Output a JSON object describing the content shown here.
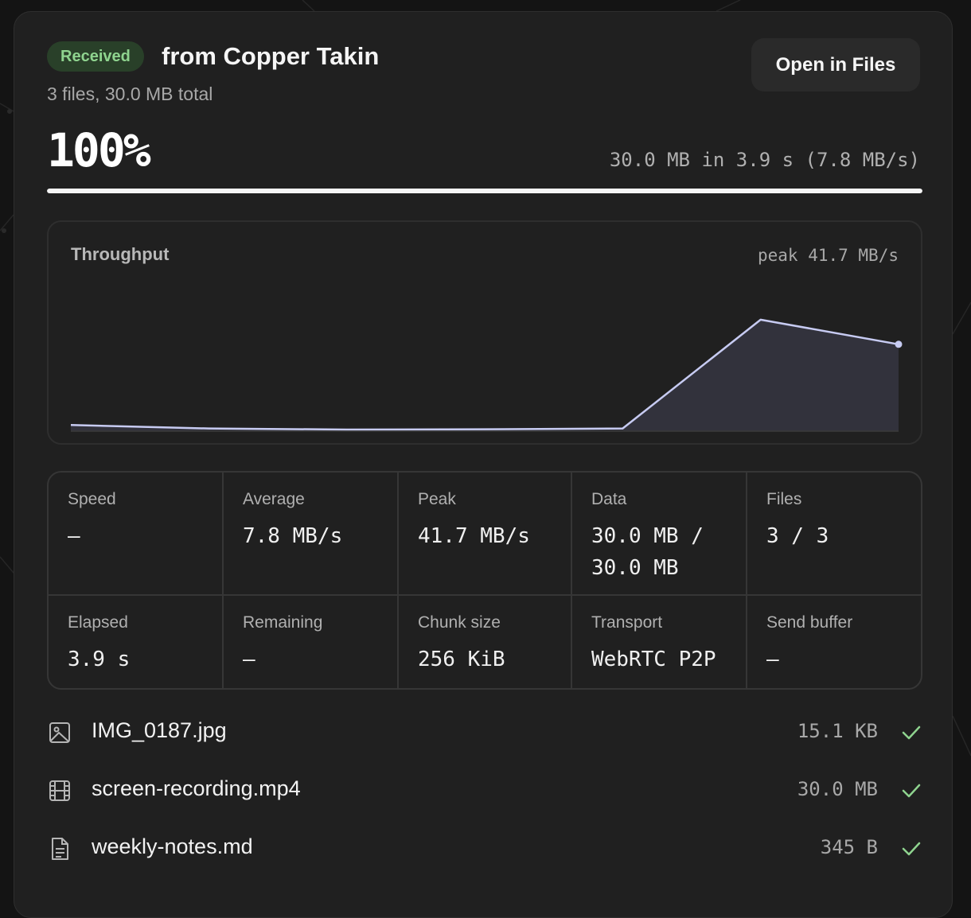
{
  "header": {
    "badge": "Received",
    "title": "from Copper Takin",
    "subtitle": "3 files, 30.0 MB total",
    "open_button": "Open in Files"
  },
  "progress": {
    "percent_label": "100%",
    "fraction": 1.0,
    "summary": "30.0 MB in 3.9 s (7.8 MB/s)"
  },
  "throughput": {
    "title": "Throughput",
    "peak_label": "peak 41.7 MB/s"
  },
  "chart_data": {
    "type": "area",
    "title": "Throughput",
    "unit": "MB/s",
    "peak": 41.7,
    "values": [
      2.3,
      1.0,
      0.6,
      0.7,
      1.0,
      41.7,
      32.5
    ],
    "ylim": [
      0,
      50
    ],
    "grid": false,
    "line_color": "#c7cbf2",
    "fill_color": "#32323c"
  },
  "stats": [
    {
      "label": "Speed",
      "value": "–"
    },
    {
      "label": "Average",
      "value": "7.8 MB/s"
    },
    {
      "label": "Peak",
      "value": "41.7 MB/s"
    },
    {
      "label": "Data",
      "value": "30.0 MB / 30.0 MB"
    },
    {
      "label": "Files",
      "value": "3 / 3"
    },
    {
      "label": "Elapsed",
      "value": "3.9 s"
    },
    {
      "label": "Remaining",
      "value": "–"
    },
    {
      "label": "Chunk size",
      "value": "256 KiB"
    },
    {
      "label": "Transport",
      "value": "WebRTC P2P"
    },
    {
      "label": "Send buffer",
      "value": "–"
    }
  ],
  "files": [
    {
      "name": "IMG_0187.jpg",
      "size": "15.1 KB",
      "icon": "image-icon",
      "status": "check-icon"
    },
    {
      "name": "screen-recording.mp4",
      "size": "30.0 MB",
      "icon": "video-icon",
      "status": "check-icon"
    },
    {
      "name": "weekly-notes.md",
      "size": "345 B",
      "icon": "document-icon",
      "status": "check-icon"
    }
  ],
  "colors": {
    "accent_green": "#8fd48f",
    "badge_bg": "#294029",
    "card_bg": "#202020"
  }
}
